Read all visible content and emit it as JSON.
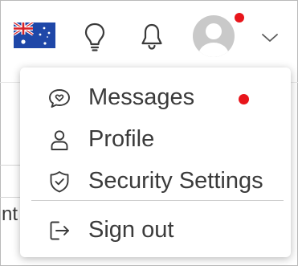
{
  "header": {
    "icons": {
      "flag": "australia-flag-icon",
      "tips": "lightbulb-icon",
      "notifications": "bell-icon",
      "avatar": "user-avatar-icon",
      "menu_toggle": "chevron-down-icon"
    }
  },
  "background": {
    "partial_text": "nt"
  },
  "menu": {
    "items": [
      {
        "label": "Messages",
        "icon": "chat-heart-icon",
        "has_notification": true
      },
      {
        "label": "Profile",
        "icon": "person-icon"
      },
      {
        "label": "Security Settings",
        "icon": "shield-check-icon"
      },
      {
        "label": "Sign out",
        "icon": "sign-out-icon"
      }
    ]
  },
  "colors": {
    "notification_dot": "#e8151b",
    "icon_stroke": "#3a3a3a",
    "text": "#3b3b3b",
    "flag_blue": "#1f47a8",
    "flag_red": "#d8232a"
  }
}
